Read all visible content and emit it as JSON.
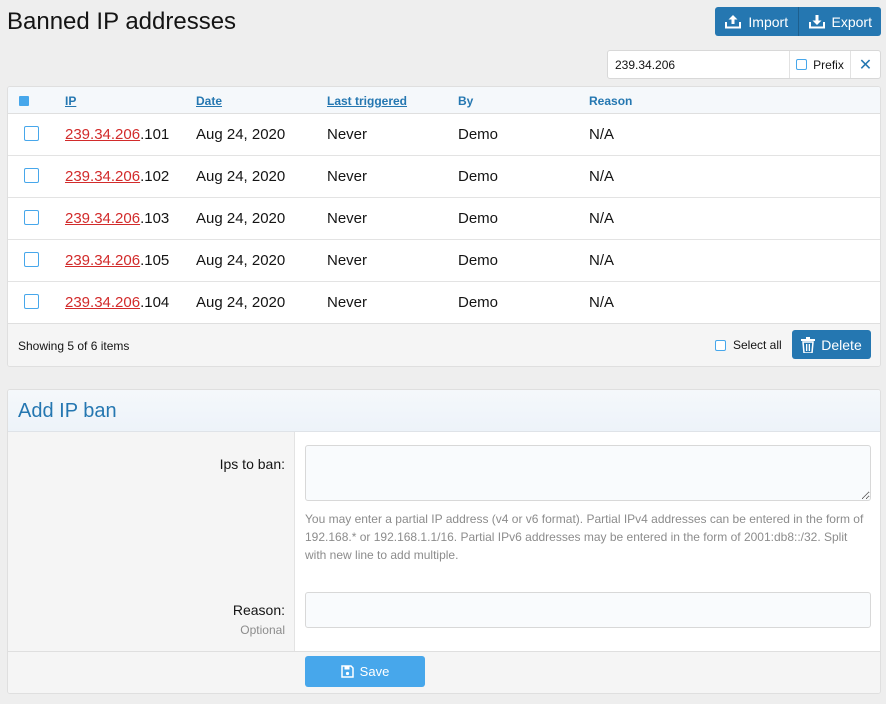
{
  "page": {
    "title": "Banned IP addresses"
  },
  "toolbar": {
    "import_label": "Import",
    "export_label": "Export"
  },
  "filter": {
    "value": "239.34.206",
    "prefix_label": "Prefix"
  },
  "table": {
    "columns": {
      "ip": "IP",
      "date": "Date",
      "last_triggered": "Last triggered",
      "by": "By",
      "reason": "Reason"
    },
    "rows": [
      {
        "ip_prefix": "239.34.206",
        "ip_suffix": ".101",
        "date": "Aug 24, 2020",
        "last_triggered": "Never",
        "by": "Demo",
        "reason": "N/A"
      },
      {
        "ip_prefix": "239.34.206",
        "ip_suffix": ".102",
        "date": "Aug 24, 2020",
        "last_triggered": "Never",
        "by": "Demo",
        "reason": "N/A"
      },
      {
        "ip_prefix": "239.34.206",
        "ip_suffix": ".103",
        "date": "Aug 24, 2020",
        "last_triggered": "Never",
        "by": "Demo",
        "reason": "N/A"
      },
      {
        "ip_prefix": "239.34.206",
        "ip_suffix": ".105",
        "date": "Aug 24, 2020",
        "last_triggered": "Never",
        "by": "Demo",
        "reason": "N/A"
      },
      {
        "ip_prefix": "239.34.206",
        "ip_suffix": ".104",
        "date": "Aug 24, 2020",
        "last_triggered": "Never",
        "by": "Demo",
        "reason": "N/A"
      }
    ],
    "footer": {
      "showing": "Showing 5 of 6 items",
      "select_all": "Select all",
      "delete_label": "Delete"
    }
  },
  "form": {
    "title": "Add IP ban",
    "ips_label": "Ips to ban:",
    "ips_value": "",
    "hint": "You may enter a partial IP address (v4 or v6 format). Partial IPv4 addresses can be entered in the form of 192.168.* or 192.168.1.1/16. Partial IPv6 addresses may be entered in the form of 2001:db8::/32. Split with new line to add multiple.",
    "reason_label": "Reason:",
    "reason_sublabel": "Optional",
    "reason_value": "",
    "save_label": "Save"
  },
  "colors": {
    "accent": "#2577b1",
    "accent_light": "#47a7eb",
    "ip_link": "#d22b2b"
  }
}
